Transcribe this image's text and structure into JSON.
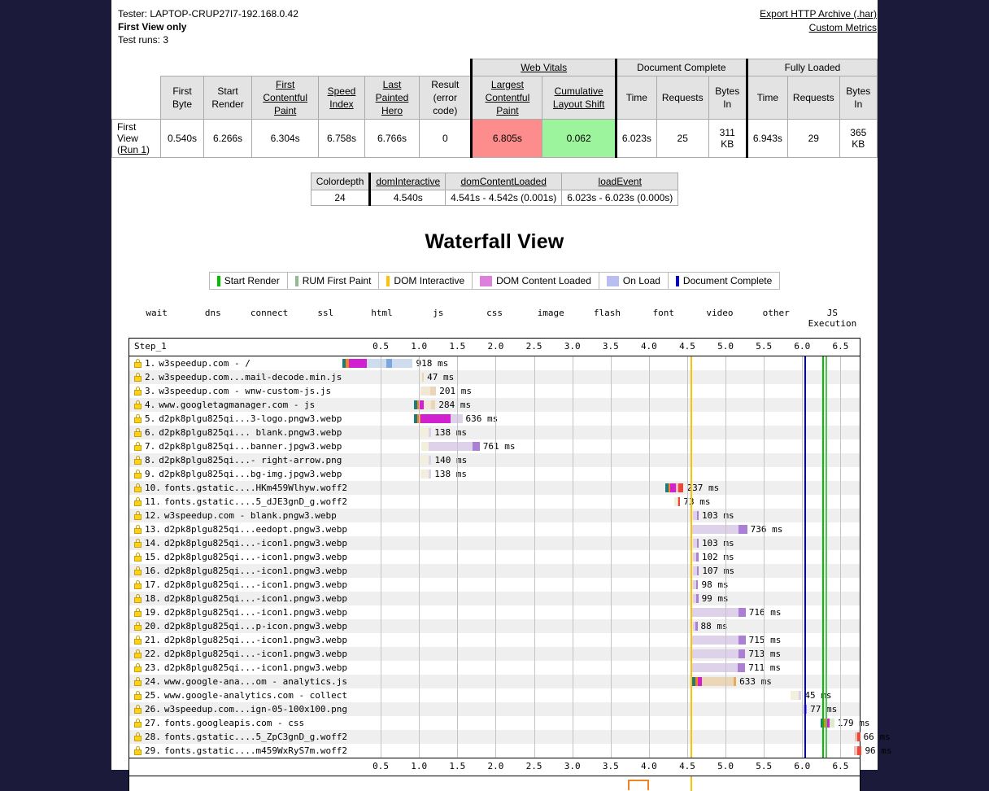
{
  "header": {
    "tester": "Tester: LAPTOP-CRUP27I7-192.168.0.42",
    "view": "First View only",
    "runs": "Test runs: 3",
    "export_link": "Export HTTP Archive (.har)",
    "custom_metrics_link": "Custom Metrics"
  },
  "metrics_table": {
    "group_headers": [
      "Web Vitals",
      "Document Complete",
      "Fully Loaded"
    ],
    "columns": [
      "First Byte",
      "Start Render",
      "First Contentful Paint",
      "Speed Index",
      "Last Painted Hero",
      "Result (error code)",
      "Largest Contentful Paint",
      "Cumulative Layout Shift",
      "Time",
      "Requests",
      "Bytes In",
      "Time",
      "Requests",
      "Bytes In"
    ],
    "row_label": "First View (",
    "row_label_link": "Run 1",
    "row_label_end": ")",
    "values": {
      "first_byte": "0.540s",
      "start_render": "6.266s",
      "first_contentful_paint": "6.304s",
      "speed_index": "6.758s",
      "last_painted_hero": "6.766s",
      "result": "0",
      "largest_contentful_paint": "6.805s",
      "cumulative_layout_shift": "0.062",
      "dc_time": "6.023s",
      "dc_requests": "25",
      "dc_bytes": "311 KB",
      "fl_time": "6.943s",
      "fl_requests": "29",
      "fl_bytes": "365 KB"
    },
    "lcp_color": "#fd8d8d",
    "cls_color": "#9cf49c"
  },
  "dom_table": {
    "columns": [
      "Colordepth",
      "domInteractive",
      "domContentLoaded",
      "loadEvent"
    ],
    "values": [
      "24",
      "4.540s",
      "4.541s - 4.542s (0.001s)",
      "6.023s - 6.023s (0.000s)"
    ]
  },
  "waterfall": {
    "title": "Waterfall View",
    "step_label": "Step_1",
    "axis_ticks": [
      "0.5",
      "1.0",
      "1.5",
      "2.0",
      "2.5",
      "3.0",
      "3.5",
      "4.0",
      "4.5",
      "5.0",
      "5.5",
      "6.0",
      "6.5"
    ],
    "axis_min": 0.0,
    "axis_max": 6.75,
    "event_legend": [
      {
        "label": "Start Render",
        "color": "#00c000",
        "wide": false
      },
      {
        "label": "RUM First Paint",
        "color": "#8fbc8f",
        "wide": false
      },
      {
        "label": "DOM Interactive",
        "color": "#ffc107",
        "wide": false
      },
      {
        "label": "DOM Content Loaded",
        "color": "#dd7fdd",
        "wide": true
      },
      {
        "label": "On Load",
        "color": "#b8bff0",
        "wide": true
      },
      {
        "label": "Document Complete",
        "color": "#0000d0",
        "wide": false
      }
    ],
    "content_legend": [
      {
        "name": "wait",
        "light": "#f2f0dc",
        "dark": "#e8e4bf"
      },
      {
        "name": "dns",
        "light": "#1e7b7b",
        "dark": "#1e7b7b"
      },
      {
        "name": "connect",
        "light": "#f58220",
        "dark": "#f58220"
      },
      {
        "name": "ssl",
        "light": "#d020d0",
        "dark": "#d020d0"
      },
      {
        "name": "html",
        "light": "#cfdcee",
        "dark": "#7ba7e0"
      },
      {
        "name": "js",
        "light": "#ecd6b8",
        "dark": "#e8a košt"
      },
      {
        "name": "css",
        "light": "#dceccd",
        "dark": "#a5d175"
      },
      {
        "name": "image",
        "light": "#ded2ea",
        "dark": "#ab7fd4"
      },
      {
        "name": "flash",
        "light": "#bfe0e4",
        "dark": "#2aa3b5"
      },
      {
        "name": "font",
        "light": "#f3bdb4",
        "dark": "#e8493a"
      },
      {
        "name": "video",
        "light": "#b9e3d6",
        "dark": "#1dae85"
      },
      {
        "name": "other",
        "light": "#e0e0e0",
        "dark": "#b5b5b5"
      },
      {
        "name": "JS Execution",
        "light": "#ff9ef0",
        "dark": "#ff9ef0"
      }
    ],
    "markers": [
      {
        "name": "dom-interactive",
        "time": 4.54,
        "color": "#ffc107"
      },
      {
        "name": "document-complete",
        "time": 6.023,
        "color": "#0000d0"
      },
      {
        "name": "start-render",
        "time": 6.266,
        "color": "#00c000"
      },
      {
        "name": "rum-first-paint",
        "time": 6.304,
        "color": "#55c255"
      }
    ],
    "requests": [
      {
        "n": "1.",
        "label": "w3speedup.com - /",
        "ms": "918 ms",
        "start": 0.0,
        "dur": 0.918,
        "segs": [
          {
            "c": "#1e7b7b",
            "f": 0.045
          },
          {
            "c": "#f58220",
            "f": 0.045
          },
          {
            "c": "#d020d0",
            "f": 0.26
          },
          {
            "c": "#cfdcee",
            "f": 0.28
          },
          {
            "c": "#7ba7e0",
            "f": 0.08
          },
          {
            "c": "#cfdcee",
            "f": 0.29
          }
        ]
      },
      {
        "n": "2.",
        "label": "w3speedup.com...mail-decode.min.js",
        "ms": "47 ms",
        "start": 1.016,
        "dur": 0.047,
        "segs": [
          {
            "c": "#f2f0dc",
            "f": 0.45
          },
          {
            "c": "#ecd6b8",
            "f": 0.55
          }
        ]
      },
      {
        "n": "3.",
        "label": "w3speedup.com - wnw-custom-js.js",
        "ms": "201 ms",
        "start": 1.022,
        "dur": 0.201,
        "segs": [
          {
            "c": "#f2e7d4",
            "f": 0.6
          },
          {
            "c": "#ecd6b8",
            "f": 0.4
          }
        ]
      },
      {
        "n": "4.",
        "label": "www.googletagmanager.com - js",
        "ms": "284 ms",
        "start": 0.93,
        "dur": 0.284,
        "segs": [
          {
            "c": "#1e7b7b",
            "f": 0.16
          },
          {
            "c": "#f58220",
            "f": 0.12
          },
          {
            "c": "#d020d0",
            "f": 0.2
          },
          {
            "c": "#f2e7d4",
            "f": 0.32
          },
          {
            "c": "#ecd6b8",
            "f": 0.2
          }
        ]
      },
      {
        "n": "5.",
        "label": "d2pk8plgu825qi...3-logo.pngw3.webp",
        "ms": "636 ms",
        "start": 0.93,
        "dur": 0.636,
        "segs": [
          {
            "c": "#1e7b7b",
            "f": 0.08
          },
          {
            "c": "#f58220",
            "f": 0.06
          },
          {
            "c": "#d020d0",
            "f": 0.62
          },
          {
            "c": "#ded2ea",
            "f": 0.24
          }
        ]
      },
      {
        "n": "6.",
        "label": "d2pk8plgu825qi... blank.pngw3.webp",
        "ms": "138 ms",
        "start": 1.022,
        "dur": 0.138,
        "segs": [
          {
            "c": "#f2f0dc",
            "f": 0.72
          },
          {
            "c": "#ded2ea",
            "f": 0.28
          }
        ]
      },
      {
        "n": "7.",
        "label": "d2pk8plgu825qi...banner.jpgw3.webp",
        "ms": "761 ms",
        "start": 1.03,
        "dur": 0.761,
        "segs": [
          {
            "c": "#f2f0dc",
            "f": 0.13
          },
          {
            "c": "#ded2ea",
            "f": 0.75
          },
          {
            "c": "#ab7fd4",
            "f": 0.12
          }
        ]
      },
      {
        "n": "8.",
        "label": "d2pk8plgu825qi...- right-arrow.png",
        "ms": "140 ms",
        "start": 1.022,
        "dur": 0.14,
        "segs": [
          {
            "c": "#f2f0dc",
            "f": 0.72
          },
          {
            "c": "#ded2ea",
            "f": 0.28
          }
        ]
      },
      {
        "n": "9.",
        "label": "d2pk8plgu825qi...bg-img.jpgw3.webp",
        "ms": "138 ms",
        "start": 1.022,
        "dur": 0.138,
        "segs": [
          {
            "c": "#f2f0dc",
            "f": 0.72
          },
          {
            "c": "#ded2ea",
            "f": 0.28
          }
        ]
      },
      {
        "n": "10.",
        "label": "fonts.gstatic....HKm459Wlhyw.woff2",
        "ms": "237 ms",
        "start": 4.215,
        "dur": 0.237,
        "segs": [
          {
            "c": "#1e7b7b",
            "f": 0.16
          },
          {
            "c": "#f58220",
            "f": 0.1
          },
          {
            "c": "#d020d0",
            "f": 0.3
          },
          {
            "c": "#f3bdb4",
            "f": 0.14
          },
          {
            "c": "#e8493a",
            "f": 0.3
          }
        ]
      },
      {
        "n": "11.",
        "label": "fonts.gstatic....5_dJE3gnD_g.woff2",
        "ms": "73 ms",
        "start": 4.335,
        "dur": 0.073,
        "segs": [
          {
            "c": "#f2f0dc",
            "f": 0.45
          },
          {
            "c": "#f3bdb4",
            "f": 0.2
          },
          {
            "c": "#e8493a",
            "f": 0.35
          }
        ]
      },
      {
        "n": "12.",
        "label": "w3speedup.com - blank.pngw3.webp",
        "ms": "103 ms",
        "start": 4.545,
        "dur": 0.103,
        "segs": [
          {
            "c": "#f2f0dc",
            "f": 0.3
          },
          {
            "c": "#ded2ea",
            "f": 0.45
          },
          {
            "c": "#ab7fd4",
            "f": 0.25
          }
        ]
      },
      {
        "n": "13.",
        "label": "d2pk8plgu825qi...eedopt.pngw3.webp",
        "ms": "736 ms",
        "start": 4.545,
        "dur": 0.736,
        "segs": [
          {
            "c": "#f2f0dc",
            "f": 0.02
          },
          {
            "c": "#ded2ea",
            "f": 0.83
          },
          {
            "c": "#ab7fd4",
            "f": 0.15
          }
        ]
      },
      {
        "n": "14.",
        "label": "d2pk8plgu825qi...-icon1.pngw3.webp",
        "ms": "103 ms",
        "start": 4.545,
        "dur": 0.103,
        "segs": [
          {
            "c": "#f2f0dc",
            "f": 0.3
          },
          {
            "c": "#ded2ea",
            "f": 0.45
          },
          {
            "c": "#ab7fd4",
            "f": 0.25
          }
        ]
      },
      {
        "n": "15.",
        "label": "d2pk8plgu825qi...-icon1.pngw3.webp",
        "ms": "102 ms",
        "start": 4.545,
        "dur": 0.102,
        "segs": [
          {
            "c": "#f2f0dc",
            "f": 0.3
          },
          {
            "c": "#ded2ea",
            "f": 0.45
          },
          {
            "c": "#ab7fd4",
            "f": 0.25
          }
        ]
      },
      {
        "n": "16.",
        "label": "d2pk8plgu825qi...-icon1.pngw3.webp",
        "ms": "107 ms",
        "start": 4.545,
        "dur": 0.107,
        "segs": [
          {
            "c": "#f2f0dc",
            "f": 0.3
          },
          {
            "c": "#ded2ea",
            "f": 0.45
          },
          {
            "c": "#ab7fd4",
            "f": 0.25
          }
        ]
      },
      {
        "n": "17.",
        "label": "d2pk8plgu825qi...-icon1.pngw3.webp",
        "ms": "98 ms",
        "start": 4.545,
        "dur": 0.098,
        "segs": [
          {
            "c": "#f2f0dc",
            "f": 0.3
          },
          {
            "c": "#ded2ea",
            "f": 0.45
          },
          {
            "c": "#ab7fd4",
            "f": 0.25
          }
        ]
      },
      {
        "n": "18.",
        "label": "d2pk8plgu825qi...-icon1.pngw3.webp",
        "ms": "99 ms",
        "start": 4.545,
        "dur": 0.099,
        "segs": [
          {
            "c": "#f2f0dc",
            "f": 0.3
          },
          {
            "c": "#ded2ea",
            "f": 0.45
          },
          {
            "c": "#ab7fd4",
            "f": 0.25
          }
        ]
      },
      {
        "n": "19.",
        "label": "d2pk8plgu825qi...-icon1.pngw3.webp",
        "ms": "716 ms",
        "start": 4.545,
        "dur": 0.716,
        "segs": [
          {
            "c": "#f2f0dc",
            "f": 0.02
          },
          {
            "c": "#ded2ea",
            "f": 0.85
          },
          {
            "c": "#ab7fd4",
            "f": 0.13
          }
        ]
      },
      {
        "n": "20.",
        "label": "d2pk8plgu825qi...p-icon.pngw3.webp",
        "ms": "88 ms",
        "start": 4.545,
        "dur": 0.088,
        "segs": [
          {
            "c": "#f2f0dc",
            "f": 0.3
          },
          {
            "c": "#ded2ea",
            "f": 0.45
          },
          {
            "c": "#ab7fd4",
            "f": 0.25
          }
        ]
      },
      {
        "n": "21.",
        "label": "d2pk8plgu825qi...-icon1.pngw3.webp",
        "ms": "715 ms",
        "start": 4.545,
        "dur": 0.715,
        "segs": [
          {
            "c": "#f2f0dc",
            "f": 0.02
          },
          {
            "c": "#ded2ea",
            "f": 0.85
          },
          {
            "c": "#ab7fd4",
            "f": 0.13
          }
        ]
      },
      {
        "n": "22.",
        "label": "d2pk8plgu825qi...-icon1.pngw3.webp",
        "ms": "713 ms",
        "start": 4.545,
        "dur": 0.713,
        "segs": [
          {
            "c": "#f2f0dc",
            "f": 0.02
          },
          {
            "c": "#ded2ea",
            "f": 0.85
          },
          {
            "c": "#ab7fd4",
            "f": 0.13
          }
        ]
      },
      {
        "n": "23.",
        "label": "d2pk8plgu825qi...-icon1.pngw3.webp",
        "ms": "711 ms",
        "start": 4.545,
        "dur": 0.711,
        "segs": [
          {
            "c": "#f2f0dc",
            "f": 0.02
          },
          {
            "c": "#ded2ea",
            "f": 0.85
          },
          {
            "c": "#ab7fd4",
            "f": 0.13
          }
        ]
      },
      {
        "n": "24.",
        "label": "www.google-ana...om - analytics.js",
        "ms": "633 ms",
        "start": 4.505,
        "dur": 0.633,
        "segs": [
          {
            "c": "#f2f0dc",
            "f": 0.1
          },
          {
            "c": "#1e7b7b",
            "f": 0.06
          },
          {
            "c": "#f58220",
            "f": 0.05
          },
          {
            "c": "#d020d0",
            "f": 0.08
          },
          {
            "c": "#ecd6b8",
            "f": 0.66
          },
          {
            "c": "#e8a95c",
            "f": 0.05
          }
        ]
      },
      {
        "n": "25.",
        "label": "www.google-analytics.com - collect",
        "ms": "45 ms",
        "start": 5.845,
        "dur": 0.145,
        "segs": [
          {
            "c": "#f2f0dc",
            "f": 0.78
          },
          {
            "c": "#ded2ea",
            "f": 0.22
          }
        ]
      },
      {
        "n": "26.",
        "label": "w3speedup.com...ign-05-100x100.png",
        "ms": "77 ms",
        "start": 5.985,
        "dur": 0.077,
        "segs": [
          {
            "c": "#f2f0dc",
            "f": 0.2
          },
          {
            "c": "#ded2ea",
            "f": 0.55
          },
          {
            "c": "#ab7fd4",
            "f": 0.25
          }
        ]
      },
      {
        "n": "27.",
        "label": "fonts.googleapis.com - css",
        "ms": "179 ms",
        "start": 6.24,
        "dur": 0.179,
        "segs": [
          {
            "c": "#1e7b7b",
            "f": 0.2
          },
          {
            "c": "#f58220",
            "f": 0.18
          },
          {
            "c": "#d020d0",
            "f": 0.3
          },
          {
            "c": "#dceccd",
            "f": 0.32
          }
        ]
      },
      {
        "n": "28.",
        "label": "fonts.gstatic....5_ZpC3gnD_g.woff2",
        "ms": "66 ms",
        "start": 6.69,
        "dur": 0.066,
        "segs": [
          {
            "c": "#f3bdb4",
            "f": 0.4
          },
          {
            "c": "#e8493a",
            "f": 0.6
          }
        ]
      },
      {
        "n": "29.",
        "label": "fonts.gstatic....m459WxRyS7m.woff2",
        "ms": "96 ms",
        "start": 6.68,
        "dur": 0.096,
        "segs": [
          {
            "c": "#f3bdb4",
            "f": 0.35
          },
          {
            "c": "#e8493a",
            "f": 0.65
          }
        ]
      }
    ]
  }
}
